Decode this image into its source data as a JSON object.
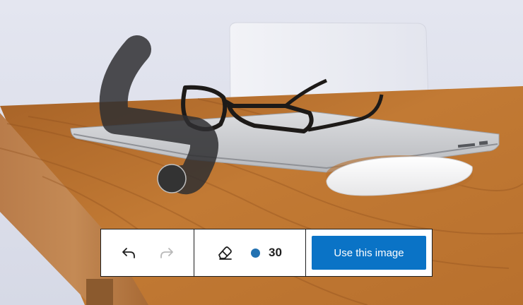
{
  "photo": {
    "description_icons": [
      "laptop",
      "glasses",
      "mouse",
      "wooden-desk",
      "chair"
    ]
  },
  "drawing": {
    "stroke_color": "#333333",
    "brush_dot_color": "#333333"
  },
  "toolbar": {
    "undo_icon": "undo-icon",
    "redo_icon": "redo-icon",
    "eraser_icon": "eraser-icon",
    "brush_size": "30",
    "brush_color": "#2271b1",
    "redo_enabled": false,
    "use_image_label": "Use this image",
    "use_image_color": "#0a73c6"
  }
}
